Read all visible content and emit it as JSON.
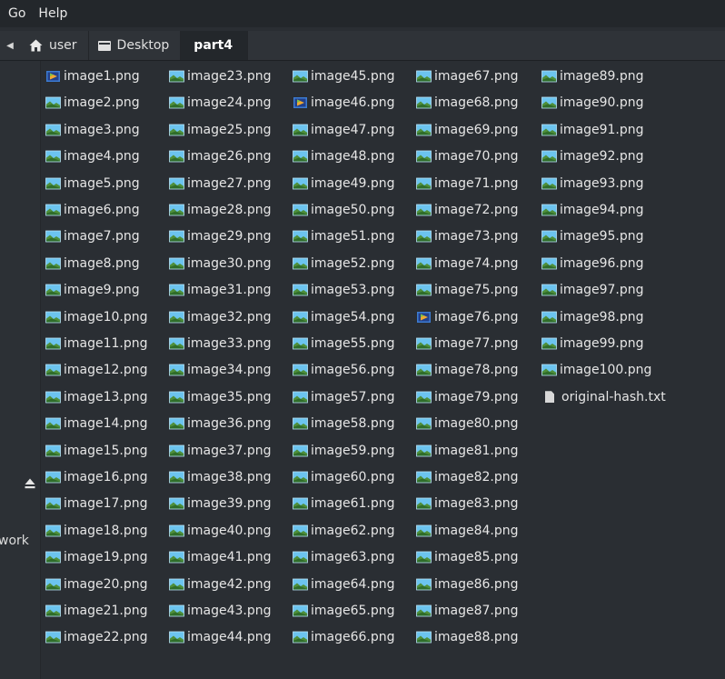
{
  "menubar": {
    "items": [
      "Go",
      "Help"
    ]
  },
  "pathbar": {
    "crumbs": [
      "user",
      "Desktop",
      "part4"
    ],
    "active": "part4"
  },
  "sidebar": {
    "label": "work"
  },
  "icons": {
    "image_file": "image-file-icon",
    "media_file": "media-file-icon",
    "text_file": "text-file-icon"
  },
  "files": {
    "columns": [
      [
        "image1.png",
        "image2.png",
        "image3.png",
        "image4.png",
        "image5.png",
        "image6.png",
        "image7.png",
        "image8.png",
        "image9.png",
        "image10.png",
        "image11.png",
        "image12.png",
        "image13.png",
        "image14.png",
        "image15.png",
        "image16.png",
        "image17.png",
        "image18.png",
        "image19.png",
        "image20.png",
        "image21.png",
        "image22.png"
      ],
      [
        "image23.png",
        "image24.png",
        "image25.png",
        "image26.png",
        "image27.png",
        "image28.png",
        "image29.png",
        "image30.png",
        "image31.png",
        "image32.png",
        "image33.png",
        "image34.png",
        "image35.png",
        "image36.png",
        "image37.png",
        "image38.png",
        "image39.png",
        "image40.png",
        "image41.png",
        "image42.png",
        "image43.png",
        "image44.png"
      ],
      [
        "image45.png",
        "image46.png",
        "image47.png",
        "image48.png",
        "image49.png",
        "image50.png",
        "image51.png",
        "image52.png",
        "image53.png",
        "image54.png",
        "image55.png",
        "image56.png",
        "image57.png",
        "image58.png",
        "image59.png",
        "image60.png",
        "image61.png",
        "image62.png",
        "image63.png",
        "image64.png",
        "image65.png",
        "image66.png"
      ],
      [
        "image67.png",
        "image68.png",
        "image69.png",
        "image70.png",
        "image71.png",
        "image72.png",
        "image73.png",
        "image74.png",
        "image75.png",
        "image76.png",
        "image77.png",
        "image78.png",
        "image79.png",
        "image80.png",
        "image81.png",
        "image82.png",
        "image83.png",
        "image84.png",
        "image85.png",
        "image86.png",
        "image87.png",
        "image88.png"
      ],
      [
        "image89.png",
        "image90.png",
        "image91.png",
        "image92.png",
        "image93.png",
        "image94.png",
        "image95.png",
        "image96.png",
        "image97.png",
        "image98.png",
        "image99.png",
        "image100.png",
        "original-hash.txt"
      ]
    ],
    "media_icon_files": [
      "image1.png",
      "image46.png",
      "image76.png"
    ],
    "text_files": [
      "original-hash.txt"
    ]
  },
  "colors": {
    "background": "#2a2e33",
    "menubar": "#23272b",
    "pathbar": "#2f3338",
    "sidebar": "#2c3035",
    "image_icon_sky": "#6cc4ef",
    "image_icon_ground": "#4f8f3a",
    "media_icon_frame": "#3c7bd1",
    "media_icon_play": "#f0a830"
  }
}
